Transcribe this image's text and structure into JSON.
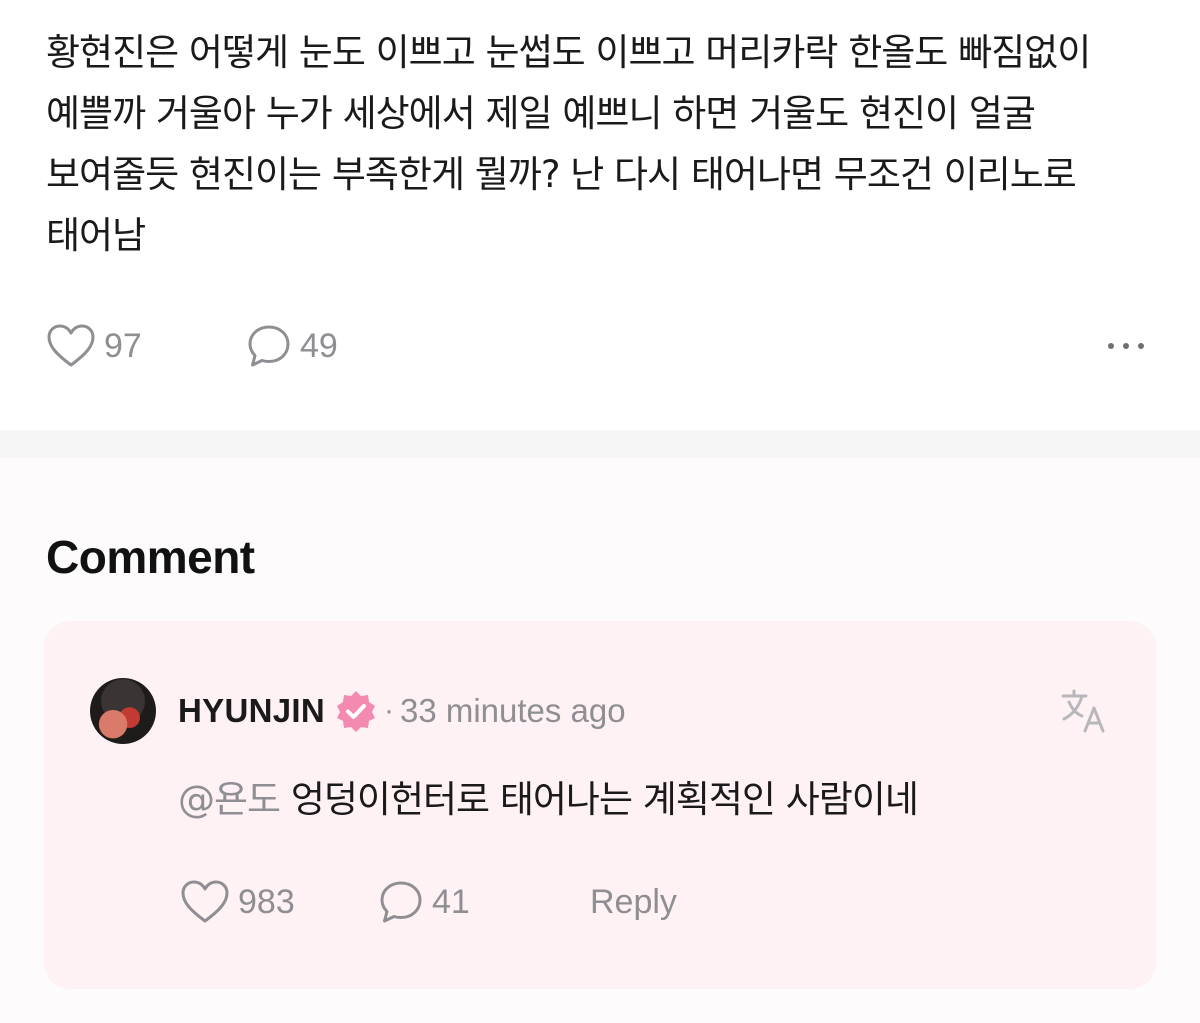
{
  "post": {
    "text": "황현진은 어떻게 눈도 이쁘고 눈썹도 이쁘고 머리카락 한올도 빠짐없이 예쁠까 거울아 누가 세상에서 제일 예쁘니 하면 거울도 현진이 얼굴 보여줄듯 현진이는 부족한게 뭘까? 난 다시 태어나면 무조건 이리노로 태어남",
    "like_icon": "heart-outline-icon",
    "like_count": "97",
    "comment_icon": "speech-bubble-icon",
    "comment_count": "49",
    "more_icon": "more-horizontal-icon"
  },
  "comments_section": {
    "title": "Comment",
    "comment": {
      "author": "HYUNJIN",
      "badge_icon": "verified-badge-icon",
      "badge_color": "#f48ab0",
      "separator": "·",
      "time": "33 minutes ago",
      "translate_icon": "translate-icon",
      "mention": "@욘도",
      "text": " 엉덩이헌터로 태어나는 계획적인 사람이네",
      "like_count": "983",
      "reply_count": "41",
      "reply_label": "Reply"
    }
  },
  "colors": {
    "card_background": "#fff2f4",
    "muted_text": "#8e8e93",
    "primary_text": "#1a1a1a"
  }
}
